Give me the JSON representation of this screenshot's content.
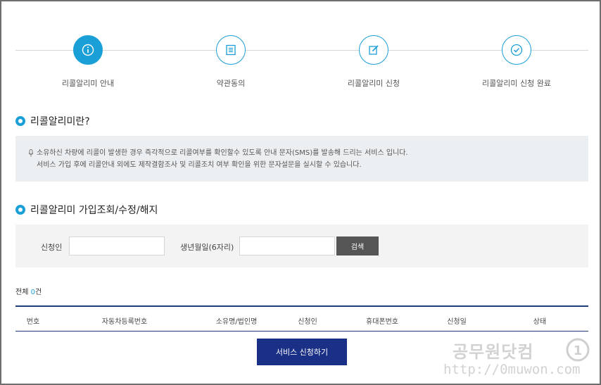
{
  "steps": [
    {
      "label": "리콜알리미 안내",
      "icon": "info-icon",
      "active": true
    },
    {
      "label": "약관동의",
      "icon": "document-icon",
      "active": false
    },
    {
      "label": "리콜알리미 신청",
      "icon": "edit-icon",
      "active": false
    },
    {
      "label": "리콜알리미 신청 완료",
      "icon": "check-icon",
      "active": false
    }
  ],
  "section1": {
    "title": "리콜알리미란?",
    "line1": "소유하신 차량에 리콜이 발생한 경우 즉각적으로 리콜여부를 확인할수 있도록 안내 문자(SMS)를 발송해 드리는 서비스 입니다.",
    "line2": "서비스 가입 후에 리콜안내 외에도 제작결함조사 및 리콜조치 여부 확인을 위한 문자설문을 실시할 수 있습니다."
  },
  "section2": {
    "title": "리콜알리미 가입조회/수정/해지"
  },
  "search": {
    "applicant_label": "신청인",
    "applicant_value": "",
    "birth_label": "생년월일(6자리)",
    "birth_value": "",
    "button": "검색"
  },
  "total": {
    "prefix": "전체 ",
    "count": "0",
    "suffix": "건"
  },
  "table": {
    "columns": [
      "번호",
      "자동차등록번호",
      "소유명/법인명",
      "신청인",
      "휴대폰번호",
      "신청일",
      "상태"
    ]
  },
  "apply_button": "서비스 신청하기",
  "watermark": {
    "title": "공무원닷컴",
    "url": "http://0muwon.com",
    "logo_text": "1"
  },
  "colors": {
    "accent": "#1b9fd7",
    "navy": "#1a2f86",
    "search_button": "#555555"
  }
}
